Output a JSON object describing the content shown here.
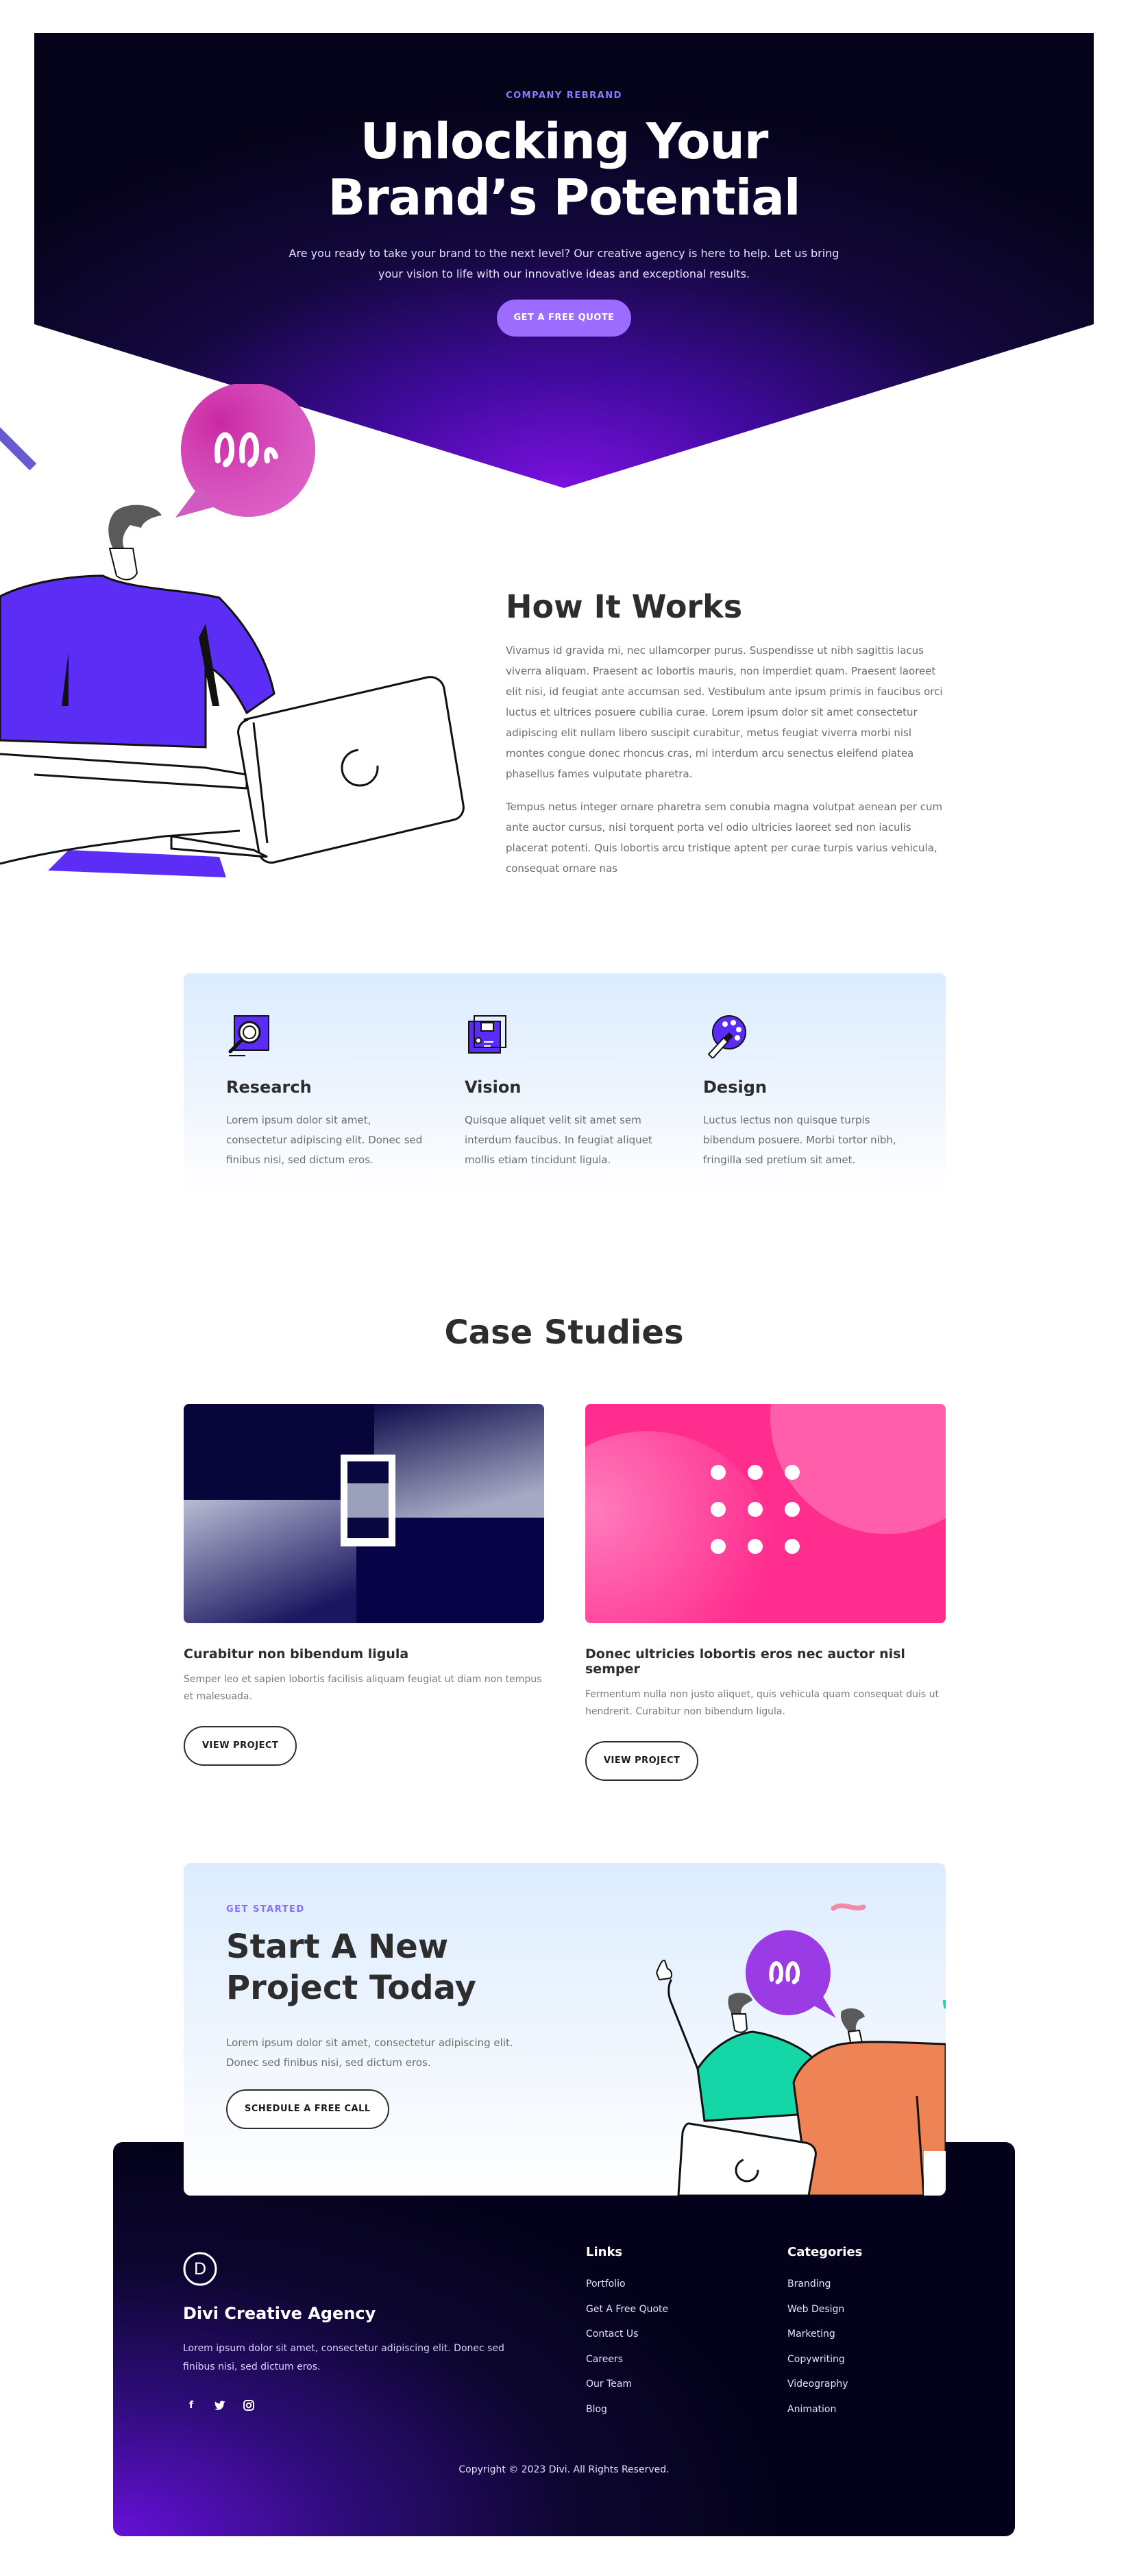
{
  "hero": {
    "eyebrow": "COMPANY REBRAND",
    "title_line1": "Unlocking Your",
    "title_line2": "Brand’s Potential",
    "description": "Are you ready to take your brand to the next level? Our creative agency is here to help. Let us bring your vision to life with our innovative ideas and exceptional results.",
    "cta_label": "GET A FREE QUOTE"
  },
  "how_it_works": {
    "title": "How It Works",
    "paragraph1": "Vivamus id gravida mi, nec ullamcorper purus. Suspendisse ut nibh sagittis lacus viverra aliquam. Praesent ac lobortis mauris, non imperdiet quam. Praesent laoreet elit nisi, id feugiat ante accumsan sed. Vestibulum ante ipsum primis in faucibus orci luctus et ultrices posuere cubilia curae. Lorem ipsum dolor sit amet consectetur adipiscing elit nullam libero suscipit curabitur, metus feugiat viverra morbi nisl montes congue donec rhoncus cras, mi interdum arcu senectus eleifend platea phasellus fames vulputate pharetra.",
    "paragraph2": "Tempus netus integer ornare pharetra sem conubia magna volutpat aenean per cum ante auctor cursus, nisi torquent porta vel odio ultricies laoreet sed non iaculis placerat potenti. Quis lobortis arcu tristique aptent per curae turpis varius vehicula, consequat ornare nas"
  },
  "features": [
    {
      "icon": "research-magnifier-icon",
      "title": "Research",
      "text": "Lorem ipsum dolor sit amet, consectetur adipiscing elit. Donec sed finibus nisi, sed dictum eros."
    },
    {
      "icon": "vision-board-icon",
      "title": "Vision",
      "text": "Quisque aliquet velit sit amet sem interdum faucibus. In feugiat aliquet mollis etiam tincidunt ligula."
    },
    {
      "icon": "design-palette-icon",
      "title": "Design",
      "text": "Luctus lectus non quisque turpis bibendum posuere. Morbi tortor nibh, fringilla sed pretium sit amet."
    }
  ],
  "case_studies": {
    "title": "Case Studies",
    "items": [
      {
        "title": "Curabitur non bibendum ligula",
        "text": "Semper leo et sapien lobortis facilisis aliquam feugiat ut diam non tempus et malesuada.",
        "button": "VIEW PROJECT"
      },
      {
        "title": "Donec ultricies lobortis eros nec auctor nisl semper",
        "text": "Fermentum nulla non justo aliquet, quis vehicula quam consequat duis ut hendrerit. Curabitur non bibendum ligula.",
        "button": "VIEW PROJECT"
      }
    ]
  },
  "cta": {
    "eyebrow": "GET STARTED",
    "title": "Start A New Project Today",
    "text": "Lorem ipsum dolor sit amet, consectetur adipiscing elit. Donec sed finibus nisi, sed dictum eros.",
    "button": "SCHEDULE A FREE CALL"
  },
  "footer": {
    "logo_letter": "D",
    "brand": "Divi Creative Agency",
    "description": "Lorem ipsum dolor sit amet, consectetur adipiscing elit. Donec sed finibus nisi, sed dictum eros.",
    "social": [
      "f",
      "t",
      "ig"
    ],
    "links_title": "Links",
    "links": [
      "Portfolio",
      "Get A Free Quote",
      "Contact Us",
      "Careers",
      "Our Team",
      "Blog"
    ],
    "categories_title": "Categories",
    "categories": [
      "Branding",
      "Web Design",
      "Marketing",
      "Copywriting",
      "Videography",
      "Animation"
    ],
    "copyright": "Copyright © 2023 Divi. All Rights Reserved."
  },
  "colors": {
    "accent_purple": "#9b6cff",
    "hero_dark": "#05031a",
    "pink": "#ff2d8e",
    "teal": "#14d6a6",
    "orange": "#ee8456",
    "violet": "#5a2cf5"
  }
}
